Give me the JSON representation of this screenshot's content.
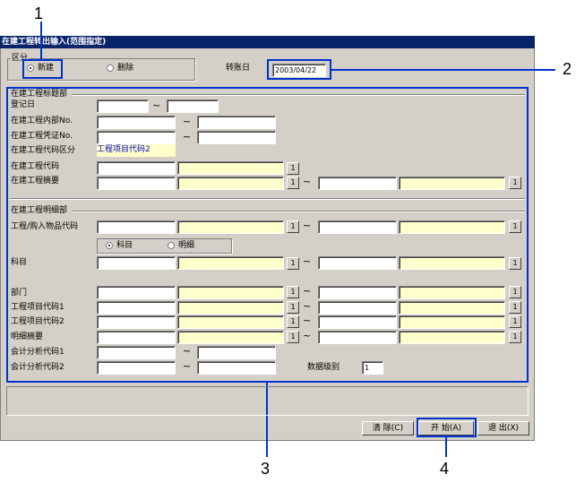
{
  "window_title": "在建工程转出输入(范围指定)",
  "callouts": [
    "1",
    "2",
    "3",
    "4"
  ],
  "kubun": {
    "label": "区分",
    "opt_new": "新建",
    "opt_delete": "删除"
  },
  "transfer_date": {
    "label": "转账日",
    "value": "2003/04/22"
  },
  "header_section": {
    "title": "在建工程标题部",
    "reg_date": "登记日",
    "internal_no": "在建工程内部No.",
    "voucher_no": "在建工程凭证No.",
    "code_kubun": "在建工程代码区分",
    "code_kubun_value": "工程项目代码2",
    "code": "在建工程代码",
    "summary": "在建工程摘要"
  },
  "detail_section": {
    "title": "在建工程明细部",
    "item_code": "工程/购入物品代码",
    "opt_account": "科目",
    "opt_detail": "明细",
    "account": "科目",
    "dept": "部门",
    "proj1": "工程项目代码1",
    "proj2": "工程项目代码2",
    "detail_summary": "明细摘要",
    "analysis1": "会计分析代码1",
    "analysis2": "会计分析代码2",
    "data_level_label": "数据级别",
    "data_level_value": "1"
  },
  "range_sep": "~",
  "lookup_btn": "1",
  "buttons": {
    "clear": "清 除(C)",
    "start": "开 始(A)",
    "exit": "退 出(X)"
  }
}
